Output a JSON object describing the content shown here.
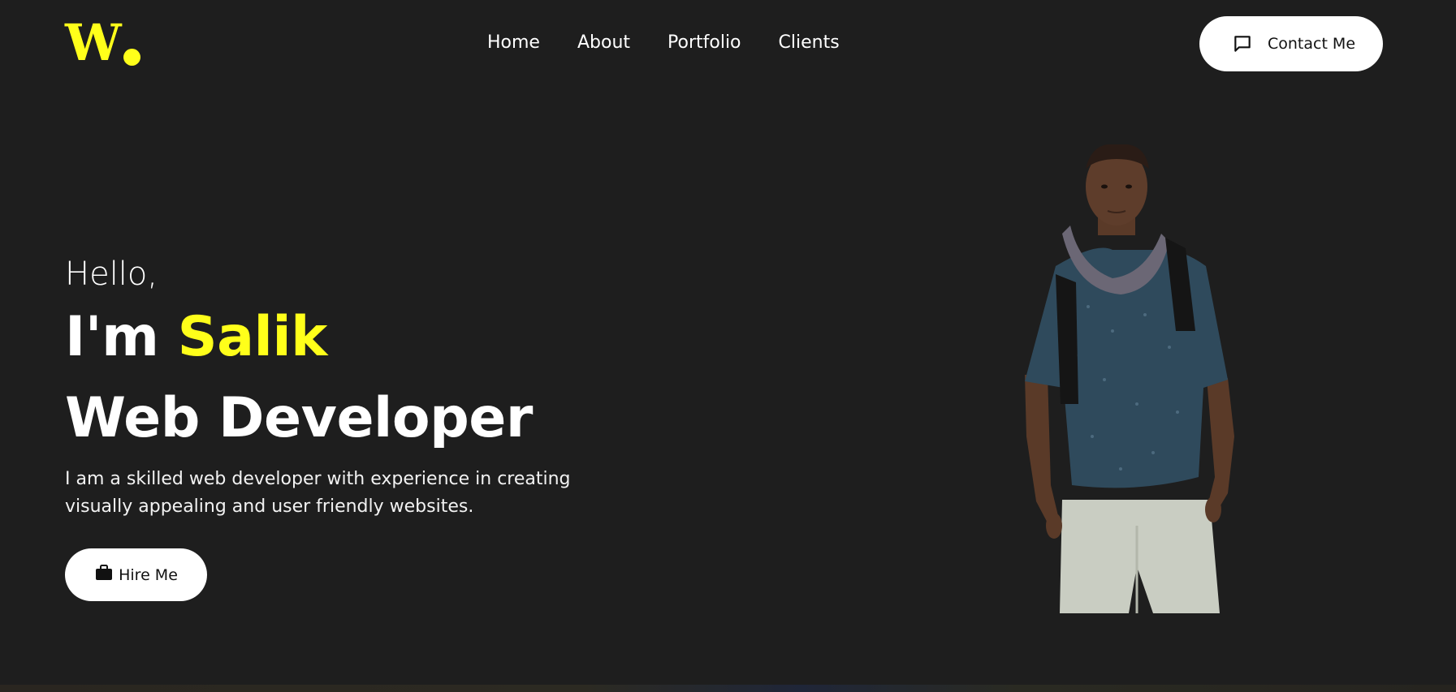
{
  "brand": {
    "logo_text": "W",
    "accent_color": "#ffff1a"
  },
  "nav": {
    "items": [
      {
        "label": "Home"
      },
      {
        "label": "About"
      },
      {
        "label": "Portfolio"
      },
      {
        "label": "Clients"
      }
    ]
  },
  "header": {
    "contact_label": "Contact Me",
    "contact_icon": "chat-bubble-icon"
  },
  "hero": {
    "greeting": "Hello,",
    "name_prefix": "I'm",
    "name": "Salik",
    "role": "Web Developer",
    "description": "I am a skilled web developer with experience in creating visually appealing and user friendly websites.",
    "hire_label": "Hire Me",
    "hire_icon": "briefcase-icon"
  },
  "colors": {
    "background": "#1e1e1e",
    "text": "#ffffff",
    "button_bg": "#ffffff",
    "button_text": "#111111"
  }
}
